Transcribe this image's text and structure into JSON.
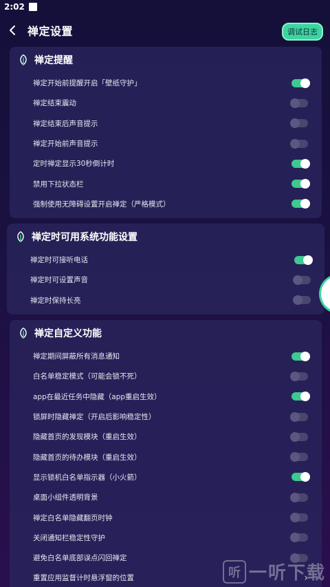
{
  "status": {
    "time": "2:02"
  },
  "header": {
    "title": "禅定设置",
    "debug_label": "调试日志"
  },
  "colors": {
    "accent": "#3dc98f",
    "toggle_off": "#4a4670",
    "card": "#28245c"
  },
  "sections": [
    {
      "title": "禅定提醒",
      "items": [
        {
          "label": "禅定开始前提醒开启「壁纸守护」",
          "on": true
        },
        {
          "label": "禅定结束震动",
          "on": false
        },
        {
          "label": "禅定结束后声音提示",
          "on": false
        },
        {
          "label": "禅定开始前声音提示",
          "on": false
        },
        {
          "label": "定时禅定显示30秒倒计时",
          "on": true
        },
        {
          "label": "禁用下拉状态栏",
          "on": true
        },
        {
          "label": "强制使用无障碍设置开启禅定（严格模式）",
          "on": true
        }
      ]
    },
    {
      "title": "禅定时可用系统功能设置",
      "items": [
        {
          "label": "禅定时可接听电话",
          "on": true
        },
        {
          "label": "禅定时可设置声音",
          "on": false
        },
        {
          "label": "禅定时保持长亮",
          "on": false
        }
      ]
    },
    {
      "title": "禅定自定义功能",
      "items": [
        {
          "label": "禅定期间屏蔽所有消息通知",
          "on": true
        },
        {
          "label": "白名单稳定模式（可能会锁不死）",
          "on": false
        },
        {
          "label": "app在最近任务中隐藏（app重启生效）",
          "on": true
        },
        {
          "label": "锁屏时隐藏禅定（开启后影响稳定性）",
          "on": false
        },
        {
          "label": "隐藏首页的发现模块（重启生效）",
          "on": false
        },
        {
          "label": "隐藏首页的待办模块（重启生效）",
          "on": false
        },
        {
          "label": "显示锁机白名单指示器（小火箭）",
          "on": true
        },
        {
          "label": "桌面小组件透明背景",
          "on": false
        },
        {
          "label": "禅定白名单隐藏翻页时钟",
          "on": false
        },
        {
          "label": "关闭通知栏稳定性守护",
          "on": false
        },
        {
          "label": "避免白名单底部误点闪回禅定",
          "on": false
        },
        {
          "label": "重置应用监督计时悬浮窗的位置",
          "chevron": true
        }
      ]
    }
  ],
  "watermark": {
    "logo": "听",
    "text": "一听下载"
  }
}
